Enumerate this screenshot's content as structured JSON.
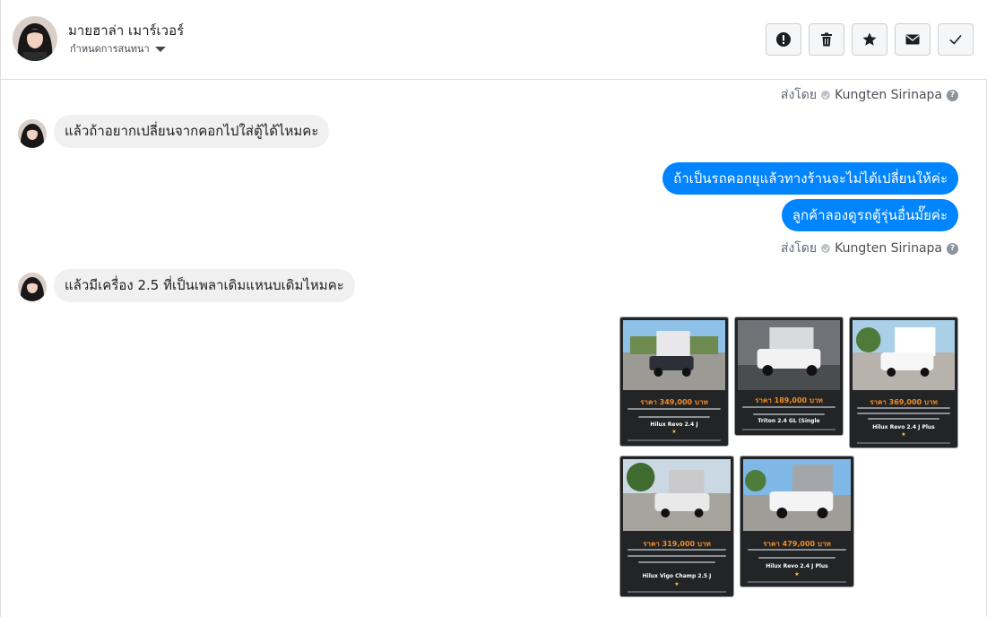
{
  "header": {
    "contact_name": "มายฮาล่า เมาร์เวอร์",
    "assign_label": "กำหนดการสนทนา",
    "actions": [
      {
        "name": "report-button",
        "icon": "exclamation-icon"
      },
      {
        "name": "delete-button",
        "icon": "trash-icon"
      },
      {
        "name": "star-button",
        "icon": "star-icon"
      },
      {
        "name": "mail-button",
        "icon": "envelope-icon"
      },
      {
        "name": "done-button",
        "icon": "check-icon"
      }
    ]
  },
  "sent_by": {
    "label": "ส่งโดย",
    "sender": "Kungten Sirinapa",
    "help": "?"
  },
  "messages": {
    "incoming_1": "แล้วถ้าอยากเปลี่ยนจากคอกไปใส่ตู้ได้ไหมคะ",
    "outgoing_1": "ถ้าเป็นรถคอกยุแล้วทางร้านจะไม่ได้เปลี่ยนให้ค่ะ",
    "outgoing_2": "ลูกค้าลองดูรถตู้รุ่นอื่นมั๊ยค่ะ",
    "incoming_2": "แล้วมีเครื่อง  2.5 ที่เป็นเพลาเดิมแหนบเดิมไหมคะ"
  },
  "cars": [
    {
      "price": "ราคา 349,000 บาท",
      "model": "Hilux Revo 2.4 J"
    },
    {
      "price": "ราคา 189,000 บาท",
      "model": "Triton 2.4 GL (Single"
    },
    {
      "price": "ราคา 369,000 บาท",
      "model": "Hilux Revo 2.4 J Plus"
    },
    {
      "price": "ราคา 319,000 บาท",
      "model": "Hilux Vigo Champ 2.5 J"
    },
    {
      "price": "ราคา 479,000 บาท",
      "model": "Hilux Revo 2.4 J Plus"
    }
  ],
  "colors": {
    "accent": "#0084ff",
    "incoming_bubble": "#f1f0f0",
    "card_bg": "#222426",
    "price": "#f28c28"
  }
}
